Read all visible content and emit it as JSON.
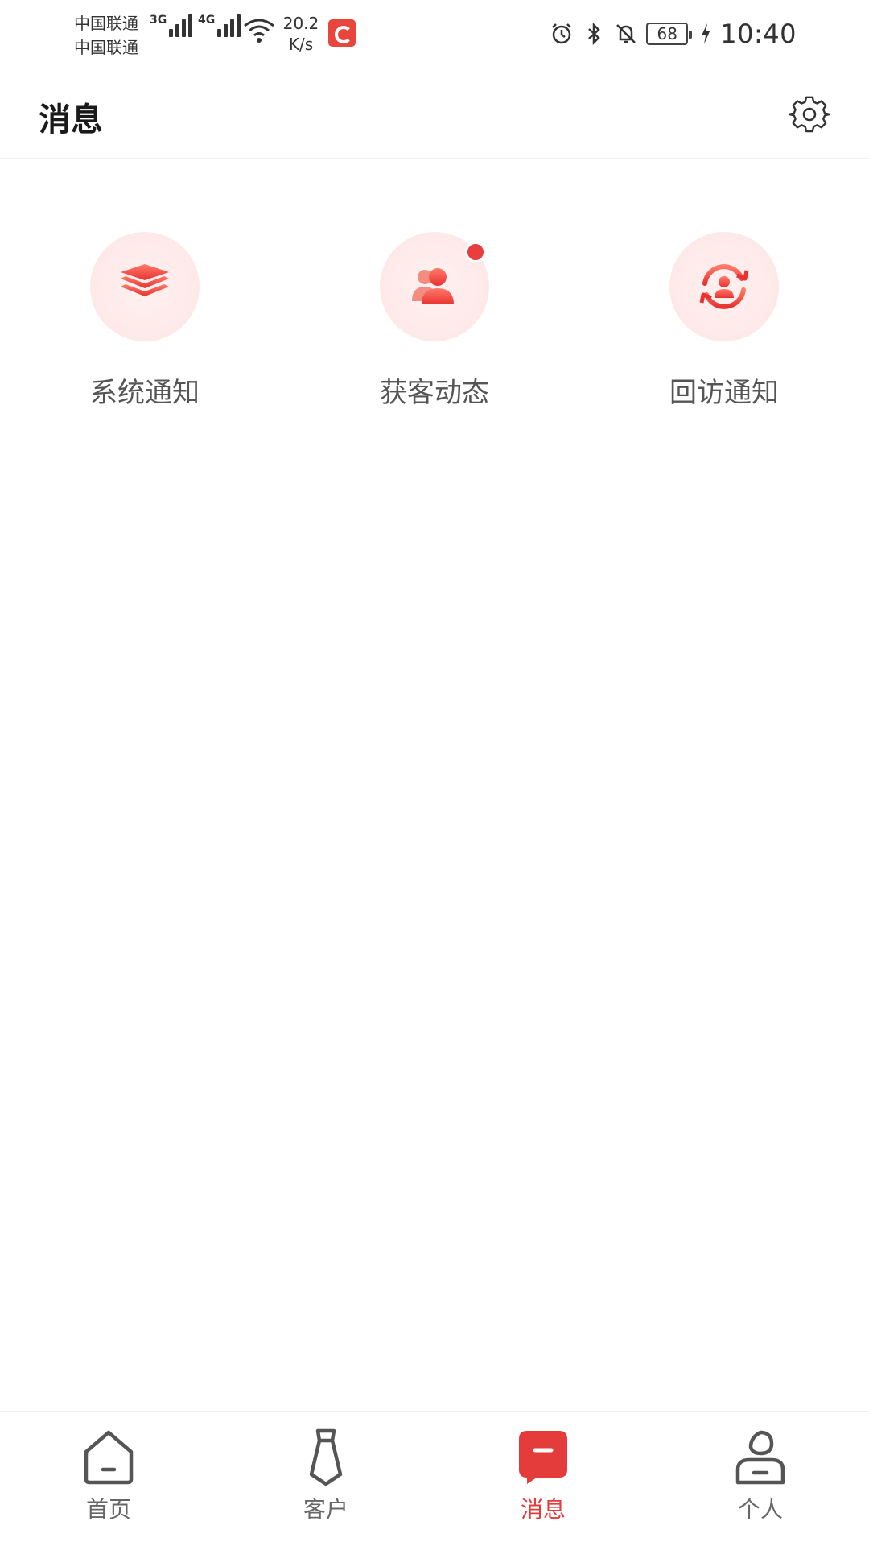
{
  "status_bar": {
    "carrier_1": "中国联通",
    "carrier_2": "中国联通",
    "net_1": "3G",
    "net_2": "4G",
    "speed_value": "20.2",
    "speed_unit": "K/s",
    "battery": "68",
    "time": "10:40",
    "icons": [
      "signal-icon",
      "wifi-icon",
      "app-icon",
      "alarm-icon",
      "bluetooth-icon",
      "mute-icon",
      "battery-icon",
      "charging-icon"
    ]
  },
  "header": {
    "title": "消息",
    "settings_icon": "gear-icon"
  },
  "categories": [
    {
      "label": "系统通知",
      "icon": "layers-icon",
      "has_badge": false
    },
    {
      "label": "获客动态",
      "icon": "users-icon",
      "has_badge": true
    },
    {
      "label": "回访通知",
      "icon": "refresh-user-icon",
      "has_badge": false
    }
  ],
  "bottom_nav": {
    "items": [
      {
        "label": "首页",
        "icon": "home-icon",
        "active": false
      },
      {
        "label": "客户",
        "icon": "tie-icon",
        "active": false
      },
      {
        "label": "消息",
        "icon": "message-icon",
        "active": true
      },
      {
        "label": "个人",
        "icon": "person-icon",
        "active": false
      }
    ]
  },
  "colors": {
    "accent": "#e43b3b",
    "icon_bg": "#fde9e8",
    "text_primary": "#1a1a1a",
    "text_secondary": "#555555"
  }
}
